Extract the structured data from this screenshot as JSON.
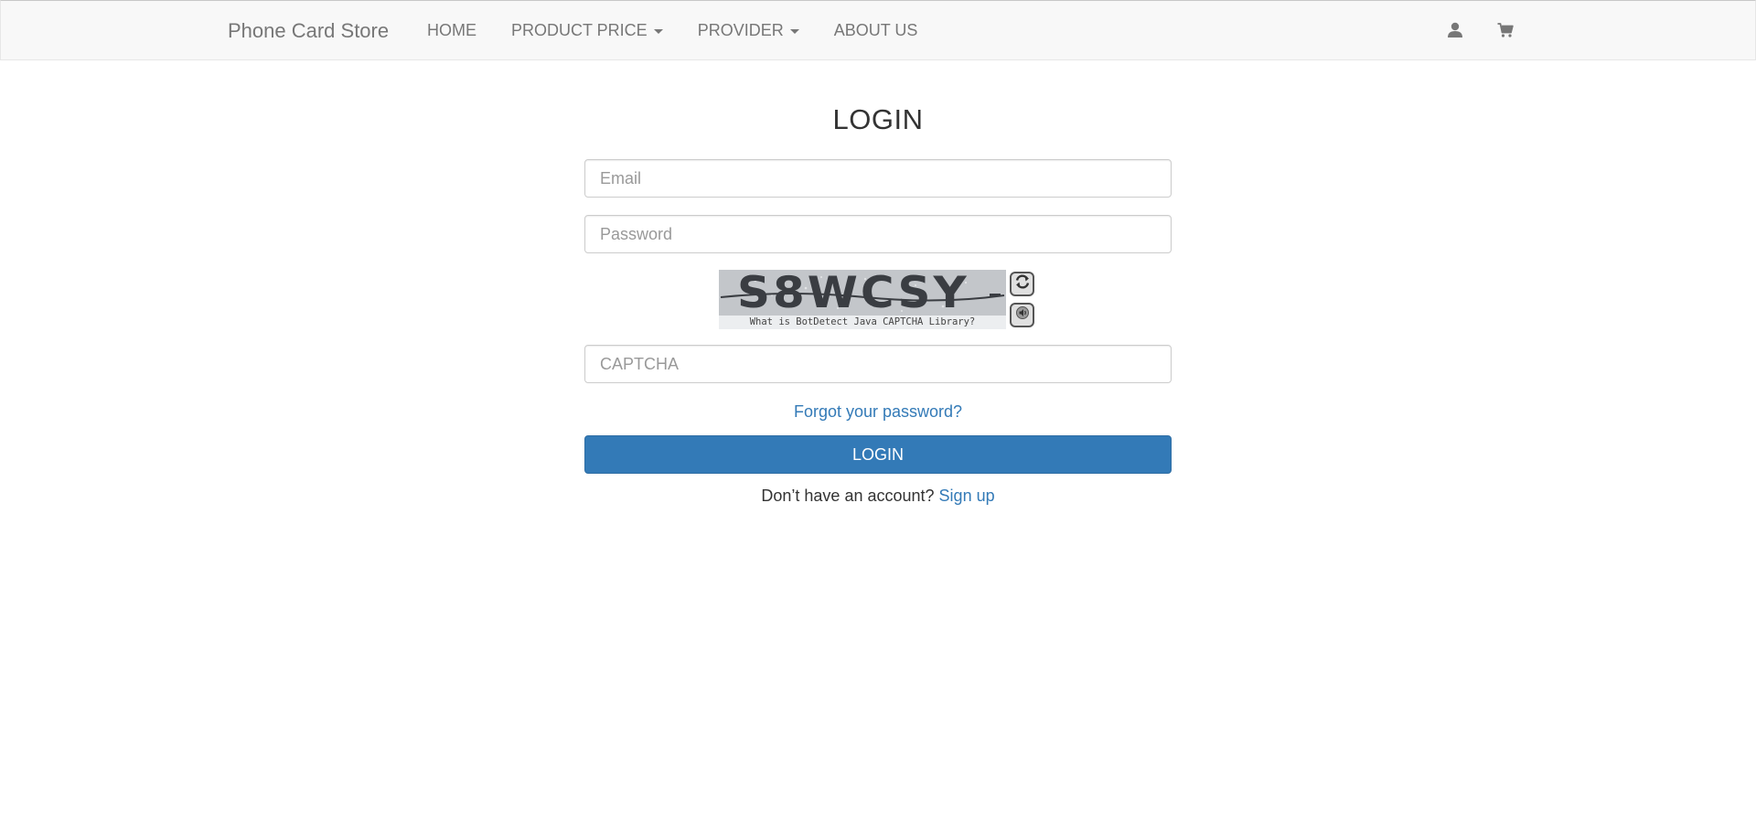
{
  "navbar": {
    "brand": "Phone Card Store",
    "items": [
      {
        "label": "HOME",
        "dropdown": false
      },
      {
        "label": "PRODUCT PRICE",
        "dropdown": true
      },
      {
        "label": "PROVIDER",
        "dropdown": true
      },
      {
        "label": "ABOUT US",
        "dropdown": false
      }
    ],
    "icons": [
      "user-icon",
      "shopping-cart-icon"
    ]
  },
  "login": {
    "title": "LOGIN",
    "email_placeholder": "Email",
    "password_placeholder": "Password",
    "captcha": {
      "code": "S8WCSY",
      "caption": "What is BotDetect Java CAPTCHA Library?",
      "icons": [
        "reload-icon",
        "sound-icon"
      ]
    },
    "captcha_placeholder": "CAPTCHA",
    "forgot_label": "Forgot your password?",
    "submit_label": "LOGIN",
    "signup_prompt": "Don’t have an account?",
    "signup_label": "Sign up"
  },
  "colors": {
    "navbar_bg": "#f8f8f8",
    "nav_text": "#777777",
    "primary": "#337ab7",
    "text": "#333333",
    "captcha_bg": "#c3c6ca"
  }
}
